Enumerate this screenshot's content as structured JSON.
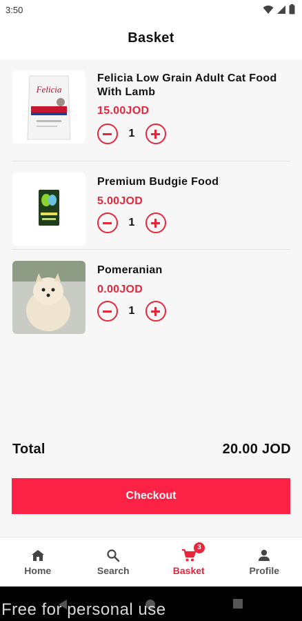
{
  "status_bar": {
    "time": "3:50"
  },
  "header": {
    "title": "Basket"
  },
  "items": [
    {
      "name": "Felicia Low Grain Adult Cat Food With Lamb",
      "price": "15.00JOD",
      "quantity": "1",
      "image": "cat-food-bag"
    },
    {
      "name": "Premium Budgie Food",
      "price": "5.00JOD",
      "quantity": "1",
      "image": "budgie-food-bag"
    },
    {
      "name": "Pomeranian",
      "price": "0.00JOD",
      "quantity": "1",
      "image": "pomeranian-photo"
    }
  ],
  "summary": {
    "total_label": "Total",
    "total_value": "20.00 JOD"
  },
  "checkout_label": "Checkout",
  "nav": [
    {
      "label": "Home",
      "icon": "home-icon",
      "active": false
    },
    {
      "label": "Search",
      "icon": "search-icon",
      "active": false
    },
    {
      "label": "Basket",
      "icon": "cart-icon",
      "active": true,
      "badge": "3"
    },
    {
      "label": "Profile",
      "icon": "person-icon",
      "active": false
    }
  ],
  "watermark": "Free for personal use",
  "colors": {
    "accent": "#e8253a",
    "button": "#fb2245"
  }
}
